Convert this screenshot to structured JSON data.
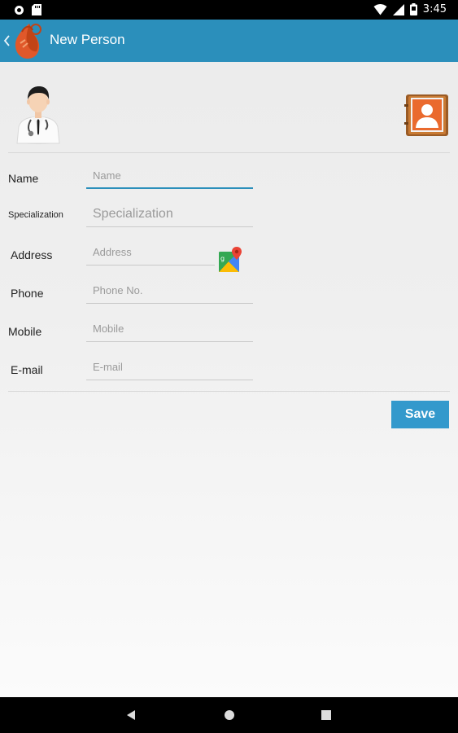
{
  "status_bar": {
    "time": "3:45",
    "icons": [
      "record-icon",
      "sd-card-icon",
      "wifi-icon",
      "signal-icon",
      "battery-icon"
    ]
  },
  "app_bar": {
    "title": "New Person",
    "color": "#2b8fbb",
    "icons": [
      "back-chevron-icon",
      "app-logo-icon"
    ]
  },
  "header": {
    "icons": [
      "doctor-avatar-icon",
      "contacts-book-icon"
    ]
  },
  "form": {
    "fields": [
      {
        "label": "Name",
        "placeholder": "Name",
        "value": ""
      },
      {
        "label": "Specialization",
        "placeholder": "Specialization",
        "value": ""
      },
      {
        "label": "Address",
        "placeholder": "Address",
        "value": ""
      },
      {
        "label": "Phone",
        "placeholder": "Phone No.",
        "value": ""
      },
      {
        "label": "Mobile",
        "placeholder": "Mobile",
        "value": ""
      },
      {
        "label": "E-mail",
        "placeholder": "E-mail",
        "value": ""
      }
    ],
    "address_icon": "google-maps-icon",
    "save_label": "Save",
    "save_color": "#3399cc"
  },
  "nav_bar": {
    "icons": [
      "back-triangle-icon",
      "home-circle-icon",
      "recents-square-icon"
    ]
  }
}
